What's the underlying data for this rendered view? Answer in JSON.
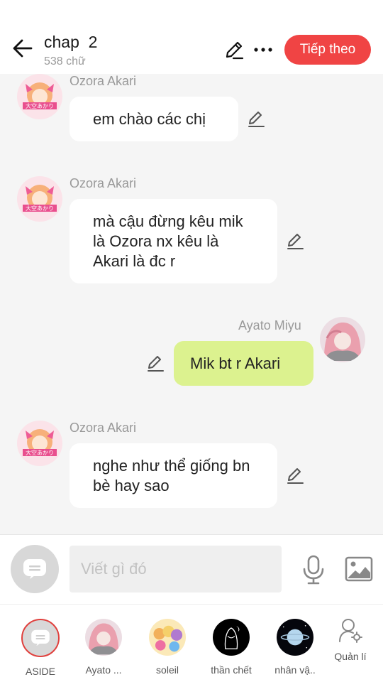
{
  "header": {
    "title": "chap  2",
    "word_count": "538 chữ",
    "next_label": "Tiếp theo",
    "accent_color": "#f04444"
  },
  "messages": [
    {
      "sender": "Ozora Akari",
      "text": "em chào các chị",
      "side": "left"
    },
    {
      "sender": "Ozora Akari",
      "text": "mà cậu đừng kêu mik là Ozora nx kêu là Akari là đc r",
      "side": "left"
    },
    {
      "sender": "Ayato  Miyu",
      "text": "Mik bt r Akari",
      "side": "right"
    },
    {
      "sender": "Ozora Akari",
      "text": "nghe như thể giống bn bè hay sao",
      "side": "left"
    }
  ],
  "composer": {
    "placeholder": "Viết gì đó",
    "icons": [
      "chat-bubble-icon",
      "microphone-icon",
      "image-icon"
    ]
  },
  "characters": [
    {
      "label": "ASIDE",
      "icon": "aside-chat-icon",
      "selected": true
    },
    {
      "label": "Ayato ...",
      "icon": "avatar-ayato"
    },
    {
      "label": "soleil",
      "icon": "avatar-soleil"
    },
    {
      "label": "thần chết",
      "icon": "avatar-than-chet"
    },
    {
      "label": "nhân vậ..",
      "icon": "avatar-nhan-vat"
    },
    {
      "label": "Quản lí",
      "icon": "user-settings-icon"
    }
  ]
}
